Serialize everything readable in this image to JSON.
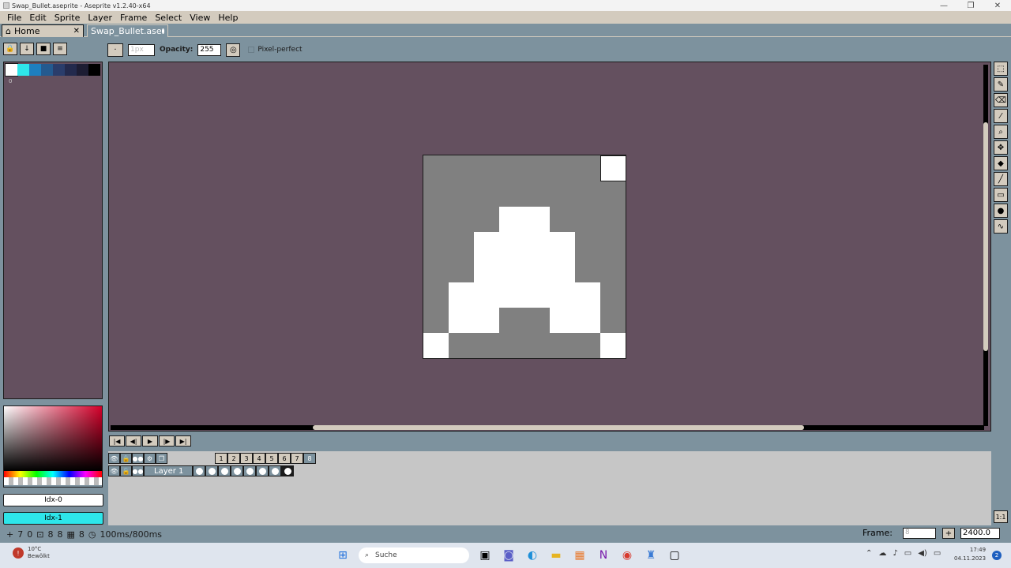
{
  "window": {
    "title": "Swap_Bullet.aseprite - Aseprite v1.2.40-x64"
  },
  "menu": [
    "File",
    "Edit",
    "Sprite",
    "Layer",
    "Frame",
    "Select",
    "View",
    "Help"
  ],
  "tabs": {
    "home": "Home",
    "file": "Swap_Bullet.ase"
  },
  "context_bar": {
    "brush_size_placeholder": "1px",
    "opacity_label": "Opacity:",
    "opacity_value": "255",
    "pixel_perfect_label": "Pixel-perfect"
  },
  "palette": {
    "colors": [
      "#ffffff",
      "#2ee6ea",
      "#1e7fbf",
      "#245a8f",
      "#2a3d6b",
      "#232a4d",
      "#1d1d33",
      "#000000"
    ],
    "index_label": "0"
  },
  "color_indices": {
    "foreground": "Idx-0",
    "background": "Idx-1"
  },
  "timeline": {
    "layer_name": "Layer 1",
    "frames": [
      "1",
      "2",
      "3",
      "4",
      "5",
      "6",
      "7",
      "8"
    ],
    "active_frame": 8
  },
  "status": {
    "items": [
      "7",
      "0",
      "8",
      "8",
      "8"
    ],
    "duration": "100ms/800ms",
    "frame_label": "Frame:",
    "frame_value": "8",
    "zoom": "2400.0"
  },
  "taskbar": {
    "weather_temp": "10°C",
    "weather_desc": "Bewölkt",
    "search_label": "Suche",
    "time": "17:49",
    "date": "04.11.2023",
    "notification_count": "2"
  }
}
